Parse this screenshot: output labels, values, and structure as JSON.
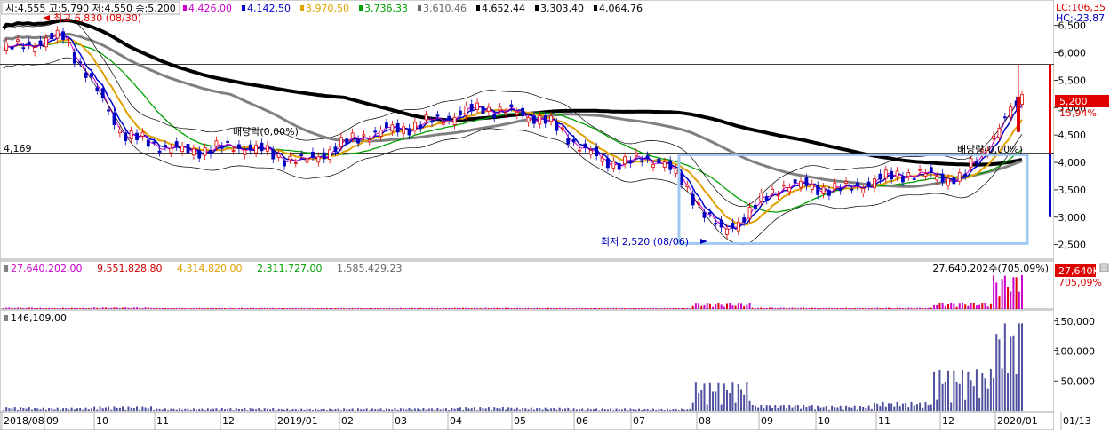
{
  "header": {
    "ohlc": "시:4,555 고:5,790 저:4,550 종:5,200",
    "ma_values": [
      {
        "text": "4,426,00",
        "color": "#cc00cc"
      },
      {
        "text": "4,142,50",
        "color": "#0000cc"
      },
      {
        "text": "3,970,50",
        "color": "#e0a000"
      },
      {
        "text": "3,736,33",
        "color": "#00a000"
      },
      {
        "text": "3,610,46",
        "color": "#666666"
      },
      {
        "text": "4,652,44",
        "color": "#000000"
      },
      {
        "text": "3,303,40",
        "color": "#000000"
      },
      {
        "text": "4,064,76",
        "color": "#000000"
      }
    ]
  },
  "lc_label": "LC:106,35",
  "hc_label": "HC:-23,87",
  "price_tag": {
    "value": "5,200",
    "change": "15,94%"
  },
  "annotations": {
    "high": "최고 6,830 (08/30)",
    "low": "최저 2,520 (08/06)",
    "hline_label": "4,169",
    "dividend_1": "배당락(0,00%)",
    "dividend_2": "배당락(0,00%)"
  },
  "volume_header": [
    {
      "text": "27,640,202,00",
      "color": "#cc00cc"
    },
    {
      "text": "9,551,828,80",
      "color": "#cc0000"
    },
    {
      "text": "4,314,820,00",
      "color": "#e0a000"
    },
    {
      "text": "2,311,727,00",
      "color": "#00a000"
    },
    {
      "text": "1,585,429,23",
      "color": "#666666"
    }
  ],
  "volume_right_text": "27,640,202주(705,09%)",
  "volume_tag": {
    "value": "27,640K",
    "change": "705,09%"
  },
  "amount_header": "146,109,00",
  "x_axis_labels": [
    "2018/08",
    "09",
    "10",
    "11",
    "12",
    "2019/01",
    "02",
    "03",
    "04",
    "05",
    "06",
    "07",
    "08",
    "09",
    "10",
    "11",
    "12",
    "2020/01",
    "01/13"
  ],
  "colors": {
    "up": "#e00000",
    "down": "#0000c0",
    "ma5": "#cc00cc",
    "ma10": "#0000cc",
    "ma20": "#e0a000",
    "ma60": "#00a000",
    "ma120": "#808080",
    "ma240": "#000000",
    "box": "#a0c8f0"
  },
  "chart_data": [
    {
      "type": "line",
      "panel": "price",
      "x": [
        "2018/08",
        "09",
        "10",
        "11",
        "12",
        "2019/01",
        "02",
        "03",
        "04",
        "05",
        "06",
        "07",
        "08",
        "09",
        "10",
        "11",
        "12",
        "2020/01"
      ],
      "series": [
        {
          "name": "close",
          "values": [
            6050,
            6300,
            4500,
            4200,
            4300,
            4000,
            4500,
            4700,
            5000,
            4800,
            4000,
            4050,
            2700,
            3600,
            3500,
            3800,
            3700,
            5200
          ]
        }
      ],
      "ylim": [
        2300,
        6900
      ],
      "yticks": [
        6500,
        6000,
        5500,
        5000,
        4500,
        4000,
        3500,
        3000,
        2500
      ],
      "ytick_labels": [
        "6,500",
        "6,000",
        "5,500",
        "5,000",
        "4,500",
        "4,000",
        "3,500",
        "3,000",
        "2,500"
      ],
      "hline": 4169,
      "hline2": 5790,
      "max": 6830,
      "min": 2520
    },
    {
      "type": "bar",
      "panel": "volume",
      "x": [
        "2018/08",
        "09",
        "10",
        "11",
        "12",
        "2019/01",
        "02",
        "03",
        "04",
        "05",
        "06",
        "07",
        "08",
        "09",
        "10",
        "11",
        "12",
        "2020/01"
      ],
      "series": [
        {
          "name": "volume",
          "values": [
            1.2,
            1.0,
            1.3,
            0.8,
            0.9,
            0.7,
            0.8,
            0.9,
            1.0,
            0.9,
            0.7,
            0.8,
            4.5,
            1.1,
            0.9,
            1.0,
            5.0,
            27.6
          ]
        }
      ]
    },
    {
      "type": "bar",
      "panel": "amount",
      "x": [
        "2018/08",
        "09",
        "10",
        "11",
        "12",
        "2019/01",
        "02",
        "03",
        "04",
        "05",
        "06",
        "07",
        "08",
        "09",
        "10",
        "11",
        "12",
        "2020/01"
      ],
      "series": [
        {
          "name": "amount",
          "values": [
            6000,
            5000,
            7000,
            4000,
            4500,
            3500,
            4000,
            4500,
            6000,
            5000,
            4000,
            3500,
            48000,
            10000,
            8000,
            15000,
            70000,
            146109
          ]
        }
      ],
      "yticks": [
        150000,
        100000,
        50000
      ],
      "ytick_labels": [
        "150,000",
        "100,000",
        "50,000"
      ]
    }
  ]
}
